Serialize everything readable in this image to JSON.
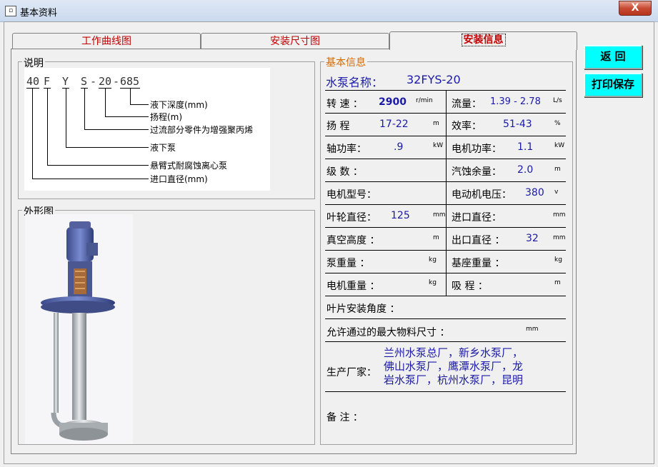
{
  "window": {
    "title": "基本资料",
    "close": "X"
  },
  "tabs": [
    "工作曲线图",
    "安装尺寸图",
    "安装信息"
  ],
  "side_buttons": {
    "back": "返 回",
    "print": "打印保存"
  },
  "explain": {
    "title": "说明",
    "code": [
      "40",
      "F",
      "Y",
      "S",
      "-",
      "20",
      "-",
      "685"
    ],
    "legend": [
      "液下深度(mm)",
      "扬程(m)",
      "过流部分零件为增强聚丙烯",
      "液下泵",
      "悬臂式耐腐蚀离心泵",
      "进口直径(mm)"
    ]
  },
  "outline": {
    "title": "外形图"
  },
  "info": {
    "title": "基本信息",
    "pump_name_label": "水泵名称：",
    "pump_name": "32FYS-20",
    "rows": [
      {
        "l_label": "转 速 ：",
        "l_value": "2900",
        "l_unit": "r/min",
        "r_label": "流量：",
        "r_value": "1.39 - 2.78",
        "r_unit": "L/s"
      },
      {
        "l_label": "扬 程",
        "l_value": "17-22",
        "l_unit": "m",
        "r_label": "效率：",
        "r_value": "51-43",
        "r_unit": "%"
      },
      {
        "l_label": "轴功率：",
        "l_value": ".9",
        "l_unit": "kW",
        "r_label": "电机功率：",
        "r_value": "1.1",
        "r_unit": "kW"
      },
      {
        "l_label": "级 数 ：",
        "l_value": "",
        "l_unit": "",
        "r_label": "汽蚀余量：",
        "r_value": "2.0",
        "r_unit": "m"
      },
      {
        "l_label": "电机型号：",
        "l_value": "",
        "l_unit": "",
        "r_label": "电动机电压：",
        "r_value": "380",
        "r_unit": "v"
      },
      {
        "l_label": "叶轮直径：",
        "l_value": "125",
        "l_unit": "mm",
        "r_label": "进口直径：",
        "r_value": "",
        "r_unit": "mm"
      },
      {
        "l_label": "真空高度 ：",
        "l_value": "",
        "l_unit": "m",
        "r_label": "出口直径 ：",
        "r_value": "32",
        "r_unit": "mm"
      },
      {
        "l_label": "泵重量 ：",
        "l_value": "",
        "l_unit": "kg",
        "r_label": "基座重量 ：",
        "r_value": "",
        "r_unit": "kg"
      },
      {
        "l_label": "电机重量 ：",
        "l_value": "",
        "l_unit": "kg",
        "r_label": "吸 程 ：",
        "r_value": "",
        "r_unit": "m"
      }
    ],
    "blade_angle_label": "叶片安装角度 ：",
    "max_material_label": "允许通过的最大物料尺寸 ：",
    "max_material_unit": "mm",
    "maker_label": "生产厂家：",
    "maker_lines": [
      "兰州水泵总厂，新乡水泵厂，",
      "佛山水泵厂，鹰潭水泵厂，龙",
      "岩水泵厂，杭州水泵厂，昆明"
    ],
    "remark_label": "备 注 ："
  },
  "colors": {
    "accent": "#c00000",
    "value": "#1a1aa6",
    "button": "#00ffff",
    "group_title": "#d46a00"
  }
}
